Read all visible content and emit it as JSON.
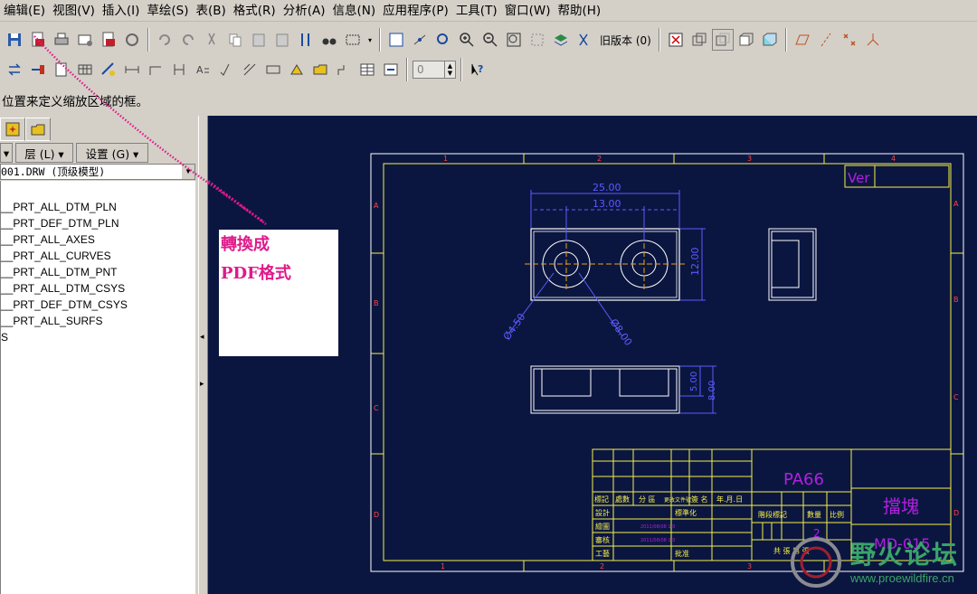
{
  "menu": [
    "编辑(E)",
    "视图(V)",
    "插入(I)",
    "草绘(S)",
    "表(B)",
    "格式(R)",
    "分析(A)",
    "信息(N)",
    "应用程序(P)",
    "工具(T)",
    "窗口(W)",
    "帮助(H)"
  ],
  "toolbar": {
    "version_label": "旧版本 (0)",
    "spin_value": "0"
  },
  "message": "位置来定义缩放区域的框。",
  "left_panel": {
    "layer_label": "层 (L) ▾",
    "settings_label": "设置 (G) ▾",
    "model": "001.DRW (顶级模型)",
    "tree": [
      "__PRT_ALL_DTM_PLN",
      "__PRT_DEF_DTM_PLN",
      "__PRT_ALL_AXES",
      "__PRT_ALL_CURVES",
      "__PRT_ALL_DTM_PNT",
      "__PRT_ALL_DTM_CSYS",
      "__PRT_DEF_DTM_CSYS",
      "__PRT_ALL_SURFS",
      "S"
    ]
  },
  "annotation": {
    "line1": "轉換成",
    "line2": "PDF格式"
  },
  "drawing": {
    "ver": "Ver",
    "dim_25": "25.00",
    "dim_13": "13.00",
    "dim_12": "12.00",
    "dim_d45": "Ø4.50",
    "dim_d8": "Ø8.00",
    "dim_5": "5.00",
    "dim_8": "8.00",
    "material": "PA66",
    "part_name": "擋塊",
    "part_no": "MD-015",
    "zone_top": [
      "1",
      "2",
      "3",
      "4"
    ],
    "zone_side": [
      "A",
      "B",
      "C",
      "D"
    ],
    "tb_row1": [
      "標記",
      "處數",
      "分 區",
      "更改文件號",
      "簽 名",
      "年.月.日"
    ],
    "tb_design": "設計",
    "tb_std": "標準化",
    "tb_draw": "繪圖",
    "tb_check": "審核",
    "tb_process": "工藝",
    "tb_approve": "批准",
    "tb_stage": "階段標記",
    "tb_weight": "數量",
    "tb_scale": "比例",
    "tb_qty": "2",
    "tb_sheet": "共 張 第 張",
    "tb_date1": "2011/08/08 1:0",
    "tb_date2": "2011/08/08 1:0"
  },
  "watermark": {
    "title": "野火论坛",
    "url": "www.proewildfire.cn"
  },
  "colors": {
    "canvas_bg": "#0b1640",
    "line_yellow": "#f5f04a",
    "line_white": "#ffffff",
    "dim_blue": "#5b5bff",
    "text_purple": "#b020e0",
    "zone_red": "#ff4444",
    "annotation_pink": "#e0198a"
  }
}
